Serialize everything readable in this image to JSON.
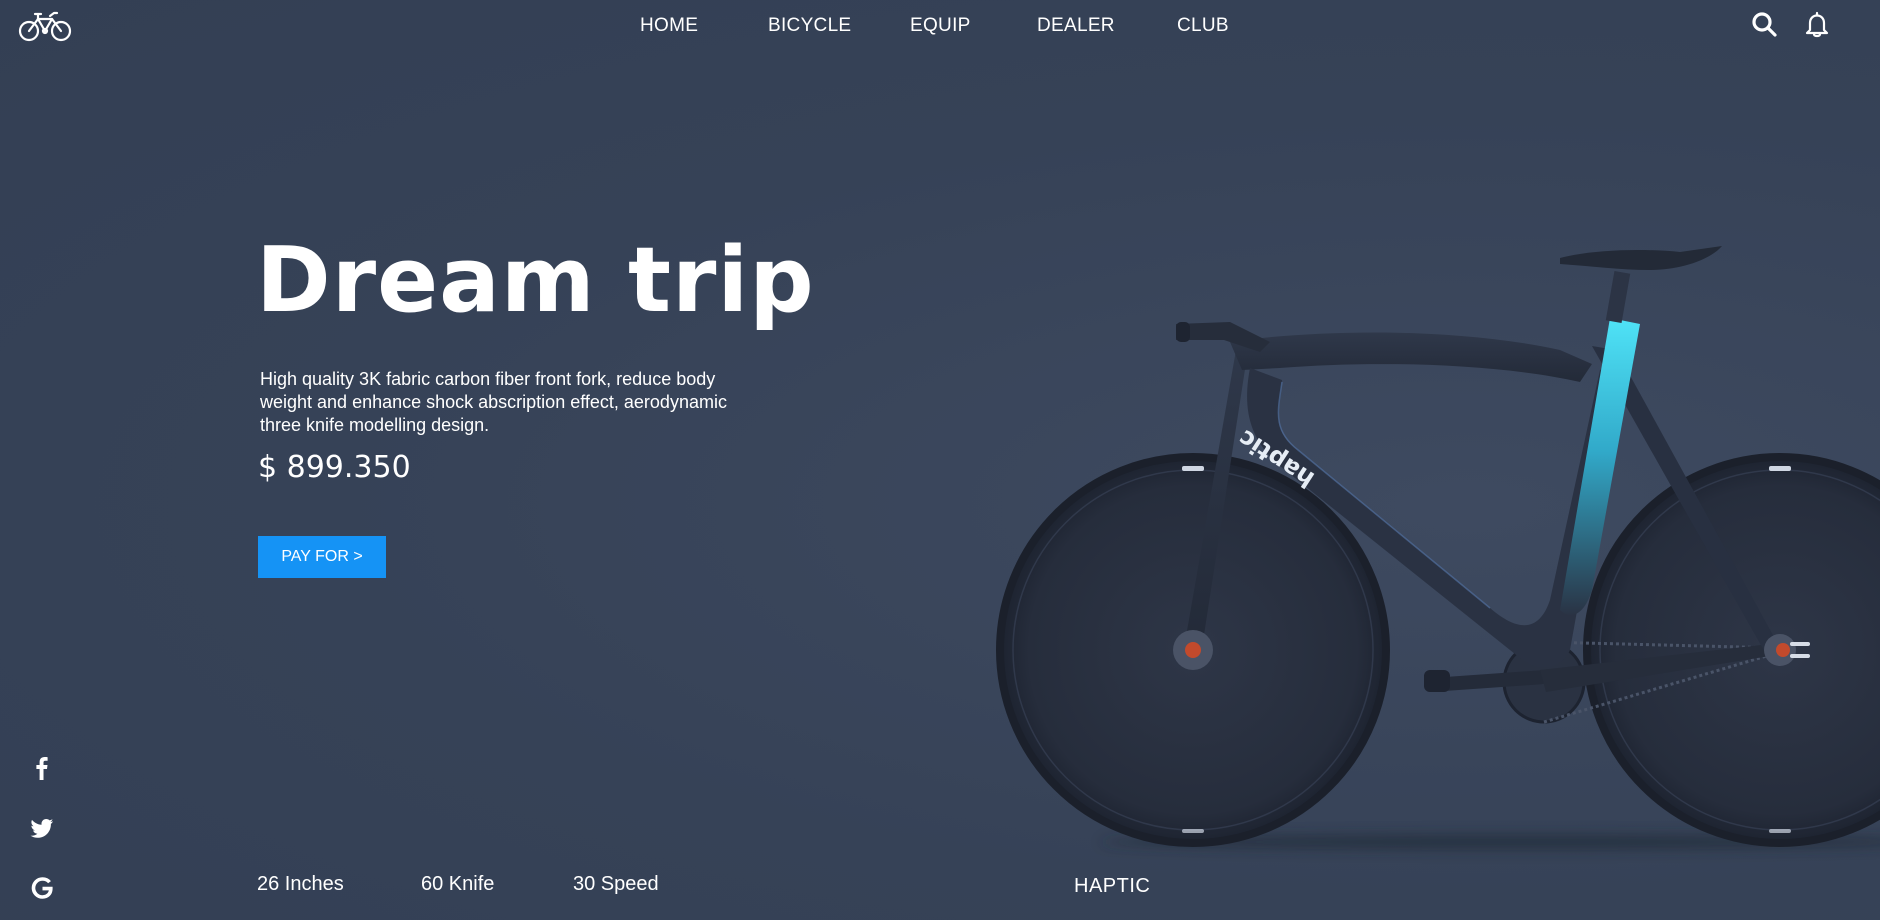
{
  "brand": {
    "logo_icon": "bicycle-icon"
  },
  "nav": {
    "items": [
      {
        "label": "HOME"
      },
      {
        "label": "BICYCLE"
      },
      {
        "label": "EQUIP"
      },
      {
        "label": "DEALER"
      },
      {
        "label": "CLUB"
      }
    ]
  },
  "toolbar": {
    "search_icon": "search-icon",
    "notification_icon": "bell-icon"
  },
  "hero": {
    "title": "Dream trip",
    "description": "High quality 3K fabric carbon fiber front fork, reduce body weight and enhance shock abscription effect, aerodynamic three knife modelling design.",
    "price": "$ 899.350",
    "cta_label": "PAY FOR >"
  },
  "social": [
    {
      "icon": "facebook-icon"
    },
    {
      "icon": "twitter-icon"
    },
    {
      "icon": "google-icon"
    }
  ],
  "specs": [
    {
      "label": "26 Inches"
    },
    {
      "label": "60 Knife"
    },
    {
      "label": "30 Speed"
    }
  ],
  "product": {
    "brand_label": "HAPTIC",
    "frame_text": "haptic"
  },
  "colors": {
    "background": "#364257",
    "accent": "#1593f5",
    "text": "#ffffff",
    "frame_highlight": "#3fd3ec"
  }
}
